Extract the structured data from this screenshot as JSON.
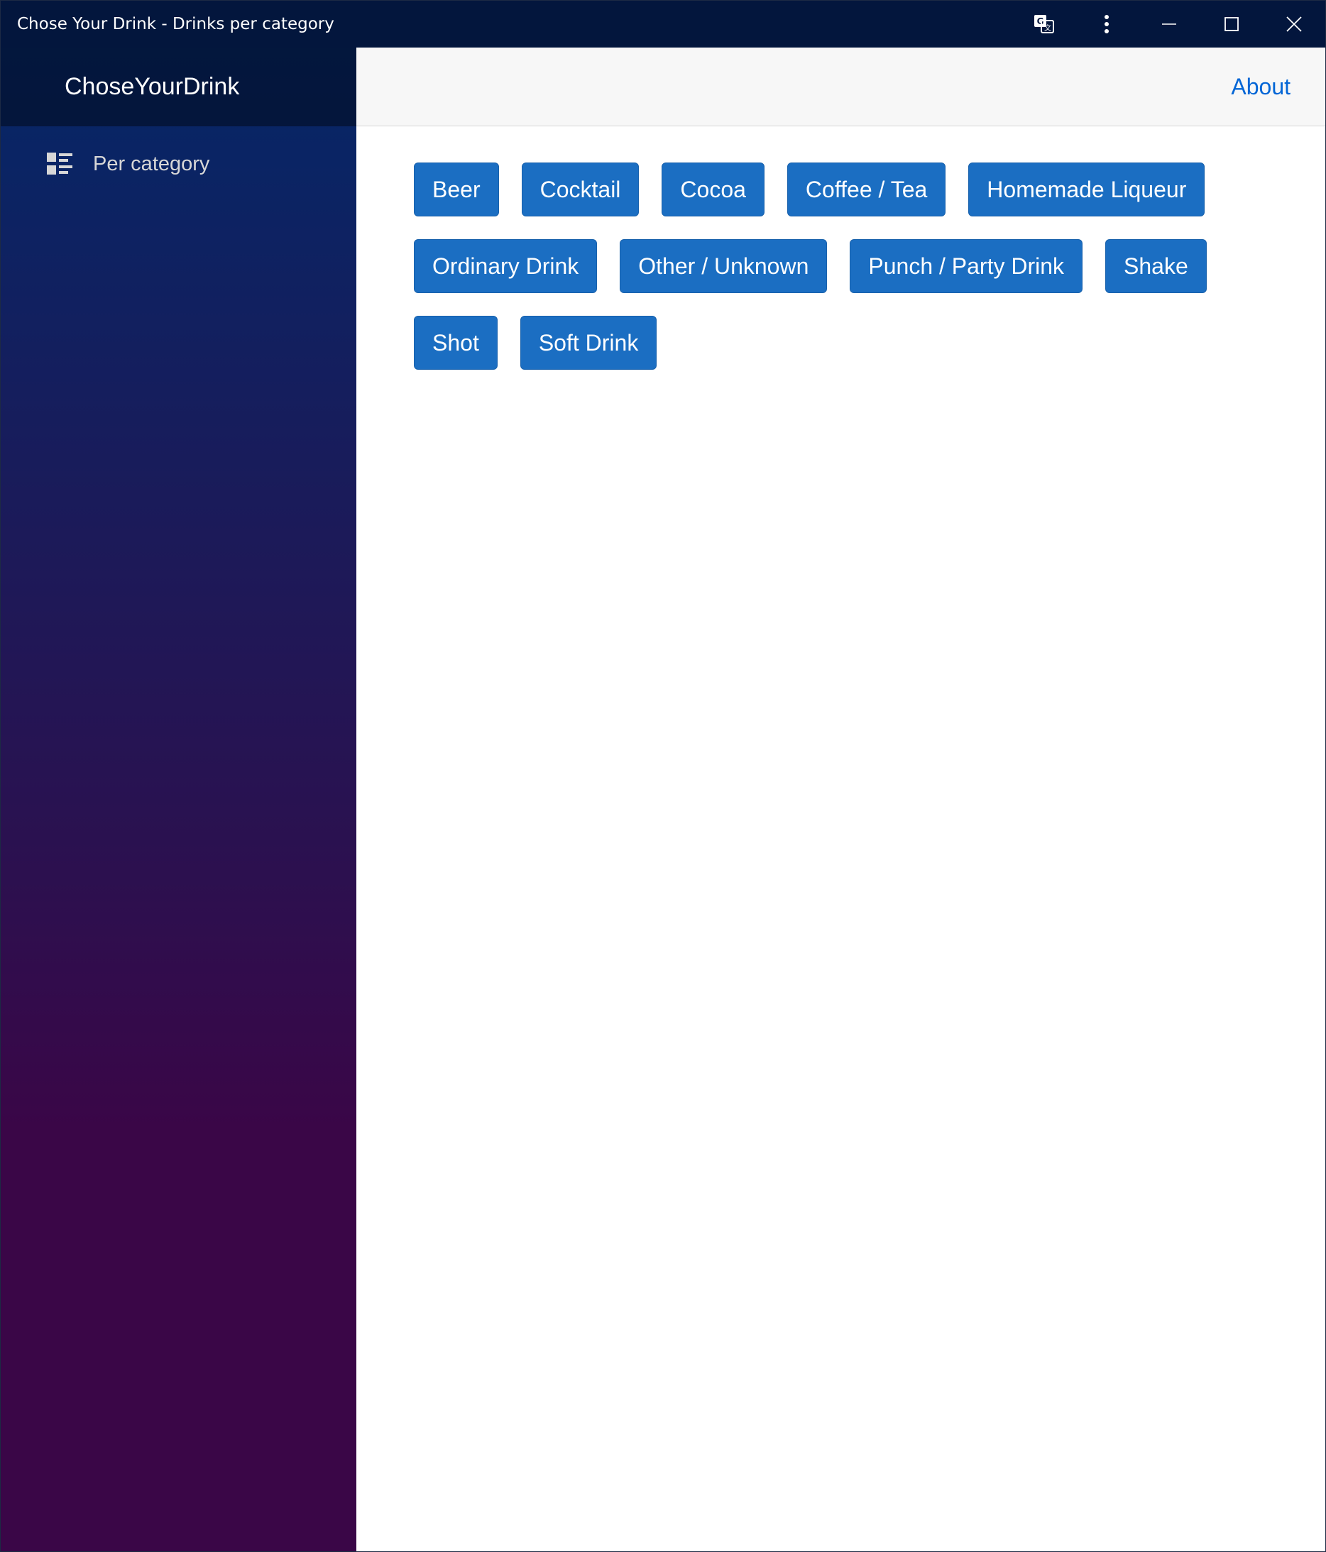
{
  "window": {
    "title": "Chose Your Drink - Drinks per category",
    "controls": [
      "translate-icon",
      "more-options-icon",
      "minimize-icon",
      "maximize-icon",
      "close-icon"
    ]
  },
  "sidebar": {
    "brand": "ChoseYourDrink",
    "items": [
      {
        "label": "Per category",
        "icon": "category-list-icon"
      }
    ]
  },
  "topbar": {
    "about_label": "About"
  },
  "categories": [
    "Beer",
    "Cocktail",
    "Cocoa",
    "Coffee / Tea",
    "Homemade Liqueur",
    "Ordinary Drink",
    "Other / Unknown",
    "Punch / Party Drink",
    "Shake",
    "Shot",
    "Soft Drink"
  ],
  "colors": {
    "titlebar": "#03163d",
    "sidebar_top": "#052767",
    "sidebar_bottom": "#3a0647",
    "button": "#1b6ec2",
    "link": "#0366d6"
  }
}
